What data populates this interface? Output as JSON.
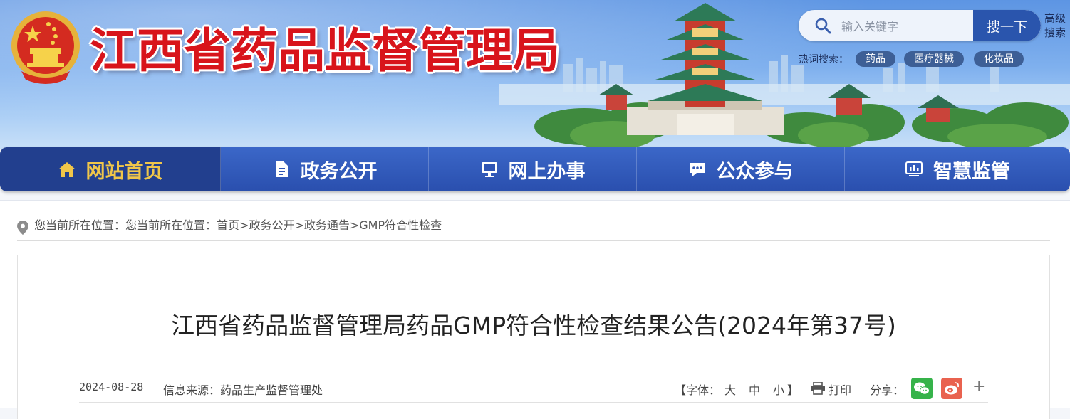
{
  "header": {
    "site_title": "江西省药品监督管理局",
    "search": {
      "placeholder": "输入关键字",
      "button_label": "搜一下",
      "advanced_label": "高级搜索"
    },
    "hot_search": {
      "label": "热词搜索：",
      "tags": [
        "药品",
        "医疗器械",
        "化妆品"
      ]
    }
  },
  "nav": {
    "items": [
      {
        "label": "网站首页",
        "icon": "home-icon",
        "active": true
      },
      {
        "label": "政务公开",
        "icon": "document-icon",
        "active": false
      },
      {
        "label": "网上办事",
        "icon": "monitor-icon",
        "active": false
      },
      {
        "label": "公众参与",
        "icon": "chat-icon",
        "active": false
      },
      {
        "label": "智慧监管",
        "icon": "dashboard-icon",
        "active": false
      }
    ]
  },
  "breadcrumb": {
    "prefix": "您当前所在位置：您当前所在位置：",
    "items": [
      "首页",
      "政务公开",
      "政务通告",
      "GMP符合性检查"
    ],
    "separator": ">"
  },
  "article": {
    "title": "江西省药品监督管理局药品GMP符合性检查结果公告(2024年第37号)",
    "date": "2024-08-28",
    "source": "信息来源：药品生产监督管理处",
    "font_label_open": "【字体：",
    "font_sizes": [
      "大",
      "中",
      "小"
    ],
    "font_label_close": "】",
    "print_label": "打印",
    "share_label": "分享：",
    "share_more": "+"
  },
  "colors": {
    "title_red": "#d8141b",
    "nav_blue": "#2a4fae",
    "nav_active_text": "#f0c64a",
    "search_button": "#2a55ad",
    "hot_tag": "#3d5f96"
  }
}
